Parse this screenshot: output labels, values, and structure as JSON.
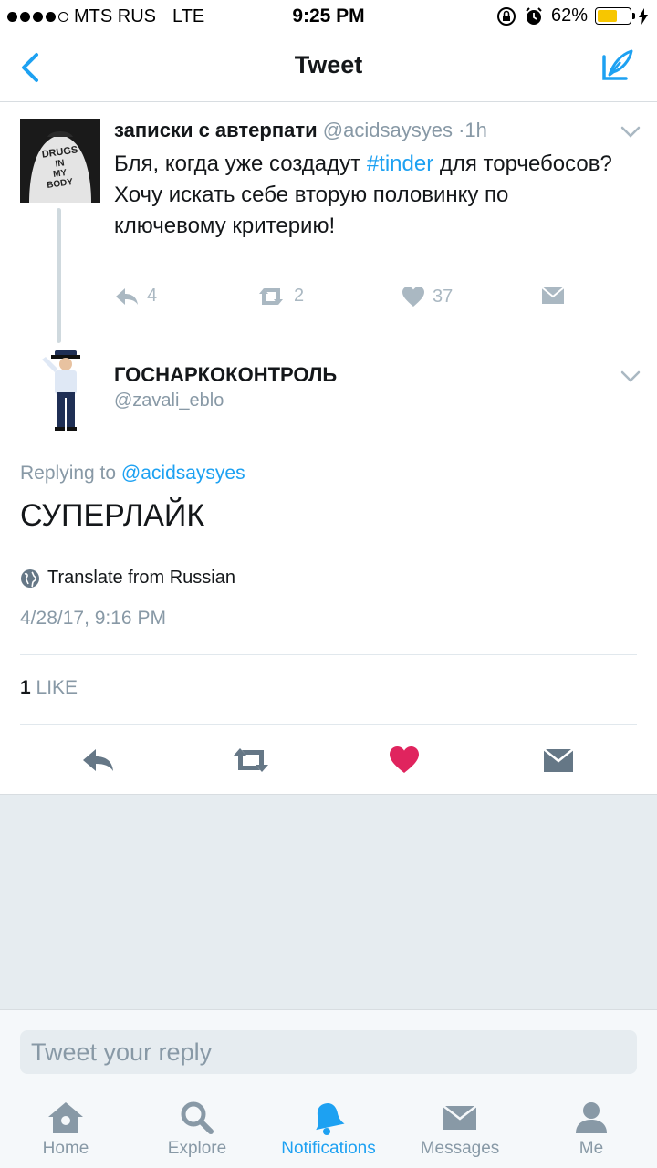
{
  "status_bar": {
    "carrier": "MTS RUS",
    "network": "LTE",
    "time": "9:25 PM",
    "battery": "62%",
    "battery_level": 0.62,
    "battery_color": "#f7c600"
  },
  "nav": {
    "title": "Tweet",
    "back_icon": "chevron-left-icon",
    "compose_icon": "compose-tweet-icon"
  },
  "parent_tweet": {
    "name": "записки с автерпати",
    "handle": "@acidsaysyes",
    "separator": "·",
    "age": "1h",
    "avatar_text": [
      "DRUGS",
      "IN",
      "MY",
      "BODY"
    ],
    "text_before": "Бля, когда уже создадут ",
    "hashtag": "#tinder",
    "text_after": " для торчебосов?",
    "text_line2": "Хочу искать себе вторую половинку по ключевому критерию!",
    "replies": "4",
    "retweets": "2",
    "likes": "37"
  },
  "reply_tweet": {
    "name": "ГОСНАРКОКОНТРОЛЬ",
    "handle": "@zavali_eblo",
    "replying_prefix": "Replying to",
    "replying_to": "@acidsaysyes",
    "text": "СУПЕРЛАЙК",
    "translate": "Translate from Russian",
    "timestamp": "4/28/17, 9:16 PM",
    "like_count": "1",
    "like_label": "LIKE",
    "liked": true,
    "liked_color": "#e0245e"
  },
  "reply_box": {
    "placeholder": "Tweet your reply"
  },
  "tabs": [
    {
      "label": "Home",
      "icon": "home-icon",
      "active": false
    },
    {
      "label": "Explore",
      "icon": "search-icon",
      "active": false
    },
    {
      "label": "Notifications",
      "icon": "bell-icon",
      "active": true
    },
    {
      "label": "Messages",
      "icon": "envelope-icon",
      "active": false
    },
    {
      "label": "Me",
      "icon": "person-icon",
      "active": false
    }
  ],
  "colors": {
    "accent": "#1da1f2",
    "secondary_text": "#8899a6",
    "icon_gray": "#aab8c2"
  }
}
